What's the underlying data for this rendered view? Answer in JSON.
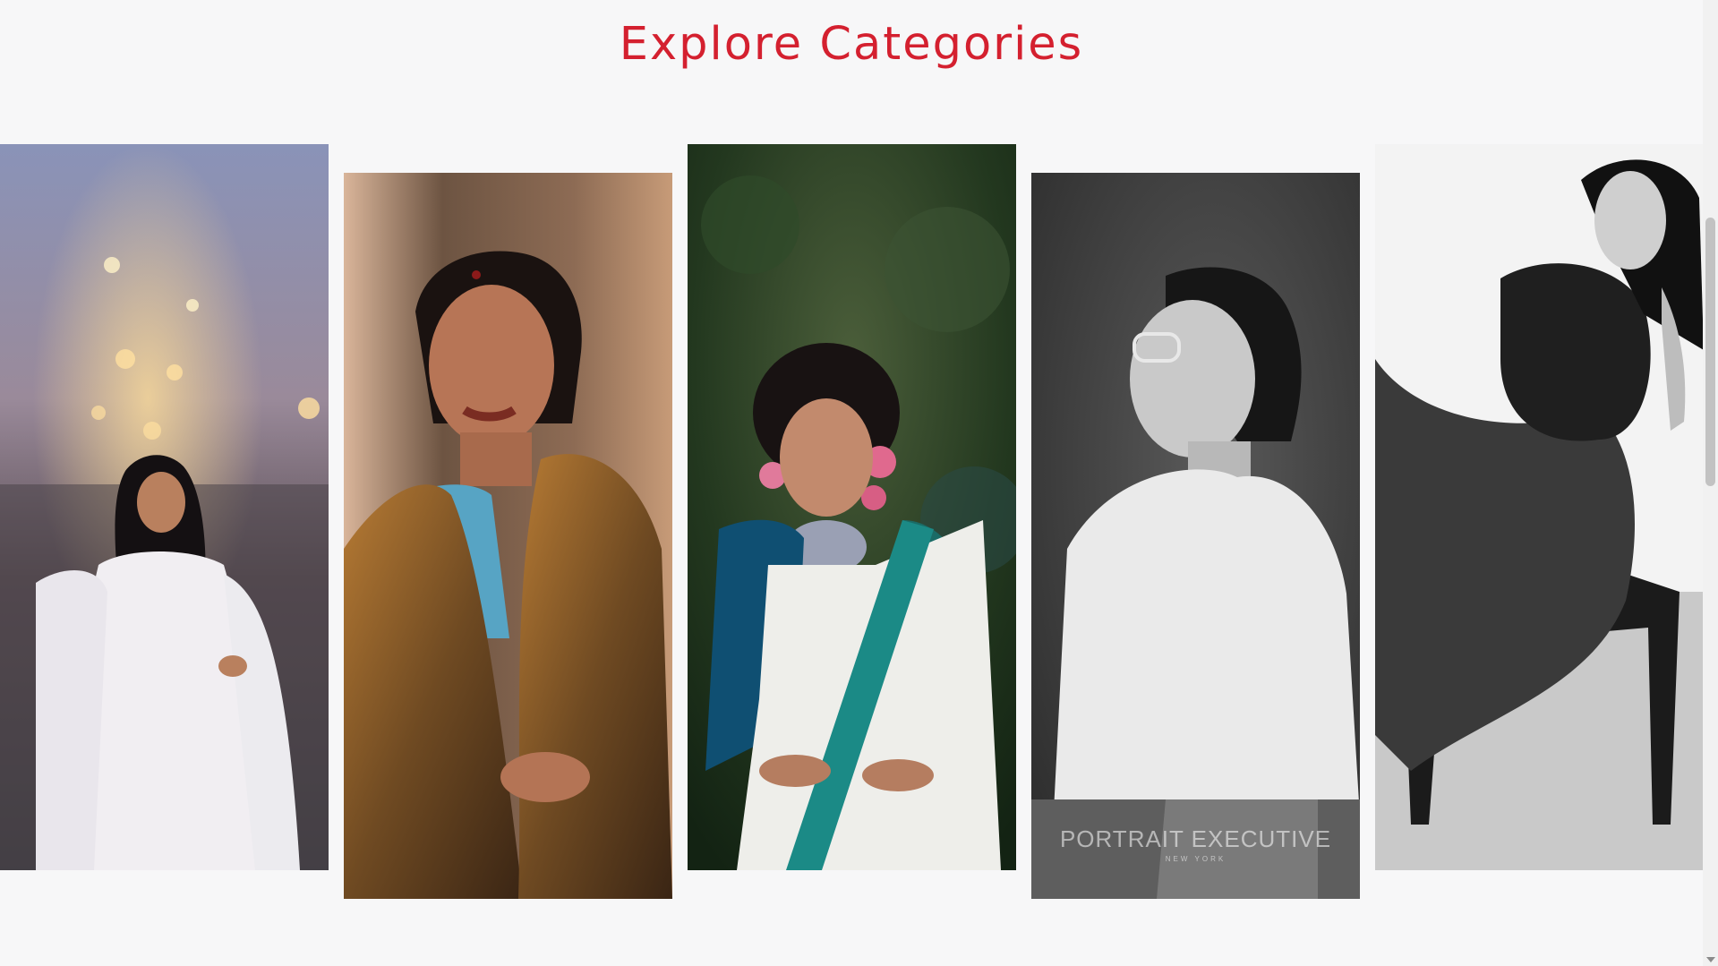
{
  "section": {
    "title": "Explore Categories",
    "title_color": "#d4202f"
  },
  "cards": [
    {
      "name": "woman in white kurta with bokeh city lights"
    },
    {
      "name": "woman in golden silk saree"
    },
    {
      "name": "woman in white kerala saree with flowers in hair"
    },
    {
      "name": "black and white portrait of smiling woman with glasses",
      "watermark": "PORTRAIT EXECUTIVE",
      "watermark_sub": "NEW YORK"
    },
    {
      "name": "black and white fashion portrait of woman on chair"
    }
  ],
  "scrollbar": {
    "position_fraction": 0.32
  }
}
